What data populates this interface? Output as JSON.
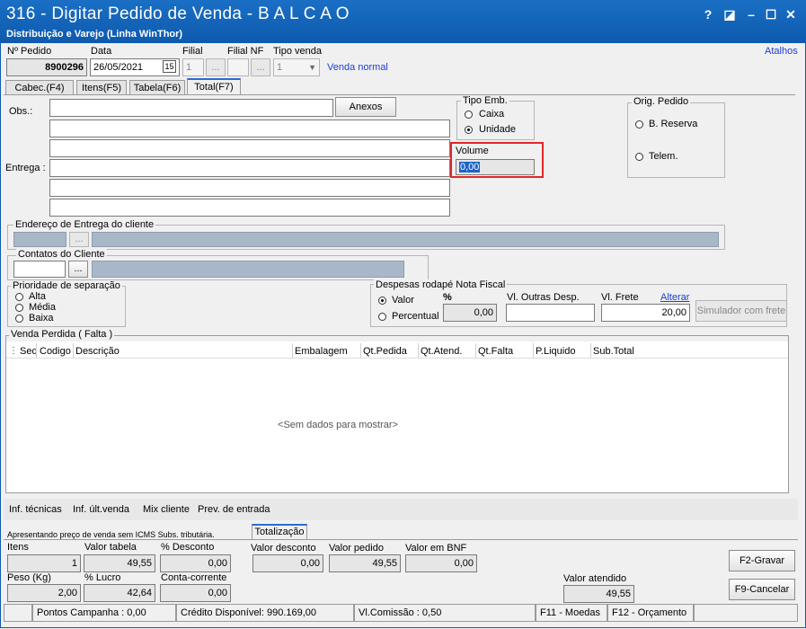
{
  "window": {
    "title": "316 - Digitar Pedido de Venda - B A L C A O",
    "subtitle": "Distribuição e Varejo (Linha WinThor)",
    "controls": [
      "?",
      "◪",
      "–",
      "☐",
      "✕"
    ]
  },
  "header": {
    "atalhos": "Atalhos",
    "pedido_label": "Nº Pedido",
    "pedido_value": "8900296",
    "data_label": "Data",
    "data_value": "26/05/2021",
    "calendar_glyph": "15",
    "filial_label": "Filial",
    "filial_value": "1",
    "filial_nf_label": "Filial NF",
    "tipo_venda_label": "Tipo venda",
    "tipo_venda_value": "1",
    "tipo_venda_text": "Venda normal",
    "ellipsis": "..."
  },
  "tabs": [
    "Cabec.(F4)",
    "Itens(F5)",
    "Tabela(F6)",
    "Total(F7)"
  ],
  "form": {
    "obs_label": "Obs.:",
    "entrega_label": "Entrega :",
    "anexos_button": "Anexos",
    "tipo_emb_label": "Tipo Emb.",
    "caixa_label": "Caixa",
    "unidade_label": "Unidade",
    "volume_label": "Volume",
    "volume_value": "0,00",
    "orig_pedido_label": "Orig. Pedido",
    "b_reserva_label": "B. Reserva",
    "telem_label": "Telem.",
    "endereco_label": "Endereço de Entrega do cliente",
    "contatos_label": "Contatos do Cliente",
    "ellipsis": "...",
    "prioridade_label": "Prioridade de separação",
    "alta_label": "Alta",
    "media_label": "Média",
    "baixa_label": "Baixa",
    "despesas_label": "Despesas rodapé Nota Fiscal",
    "valor_label": "Valor",
    "percentual_label": "Percentual",
    "pct_label": "%",
    "pct_value": "0,00",
    "outras_desp_label": "Vl. Outras Desp.",
    "vl_frete_label": "Vl. Frete",
    "alterar_link": "Alterar",
    "vl_frete_value": "20,00",
    "simulador_button": "Simulador com frete"
  },
  "venda_perdida": {
    "label": "Venda Perdida ( Falta )",
    "columns": [
      "Seq",
      "Codigo",
      "Descrição",
      "Embalagem",
      "Qt.Pedida",
      "Qt.Atend.",
      "Qt.Falta",
      "P.Liquido",
      "Sub.Total"
    ],
    "empty_text": "<Sem dados para mostrar>"
  },
  "bottom_links": [
    "Inf. técnicas",
    "Inf. últ.venda",
    "Mix cliente",
    "Prev. de entrada"
  ],
  "totals": {
    "note": "Apresentando preço de venda sem ICMS Subs. tributária.",
    "tab_label": "Totalização",
    "itens_label": "Itens",
    "itens_value": "1",
    "valor_tabela_label": "Valor tabela",
    "valor_tabela_value": "49,55",
    "desconto_label": "% Desconto",
    "desconto_value": "0,00",
    "valor_desconto_label": "Valor desconto",
    "valor_desconto_value": "0,00",
    "valor_pedido_label": "Valor pedido",
    "valor_pedido_value": "49,55",
    "valor_bnf_label": "Valor em BNF",
    "valor_bnf_value": "0,00",
    "peso_label": "Peso (Kg)",
    "peso_value": "2,00",
    "lucro_label": "% Lucro",
    "lucro_value": "42,64",
    "conta_corrente_label": "Conta-corrente",
    "conta_corrente_value": "0,00",
    "valor_atendido_label": "Valor atendido",
    "valor_atendido_value": "49,55",
    "gravar_button": "F2-Gravar",
    "cancelar_button": "F9-Cancelar"
  },
  "status": {
    "pontos": "Pontos Campanha : 0,00",
    "credito": "Crédito Disponível: 990.169,00",
    "comissao": "Vl.Comissão : 0,50",
    "moedas": "F11 - Moedas",
    "orcamento": "F12 - Orçamento"
  },
  "colors": {
    "titlebar": "#1a6fc4",
    "highlight_border": "#e0262a",
    "selection": "#1e63c8"
  }
}
